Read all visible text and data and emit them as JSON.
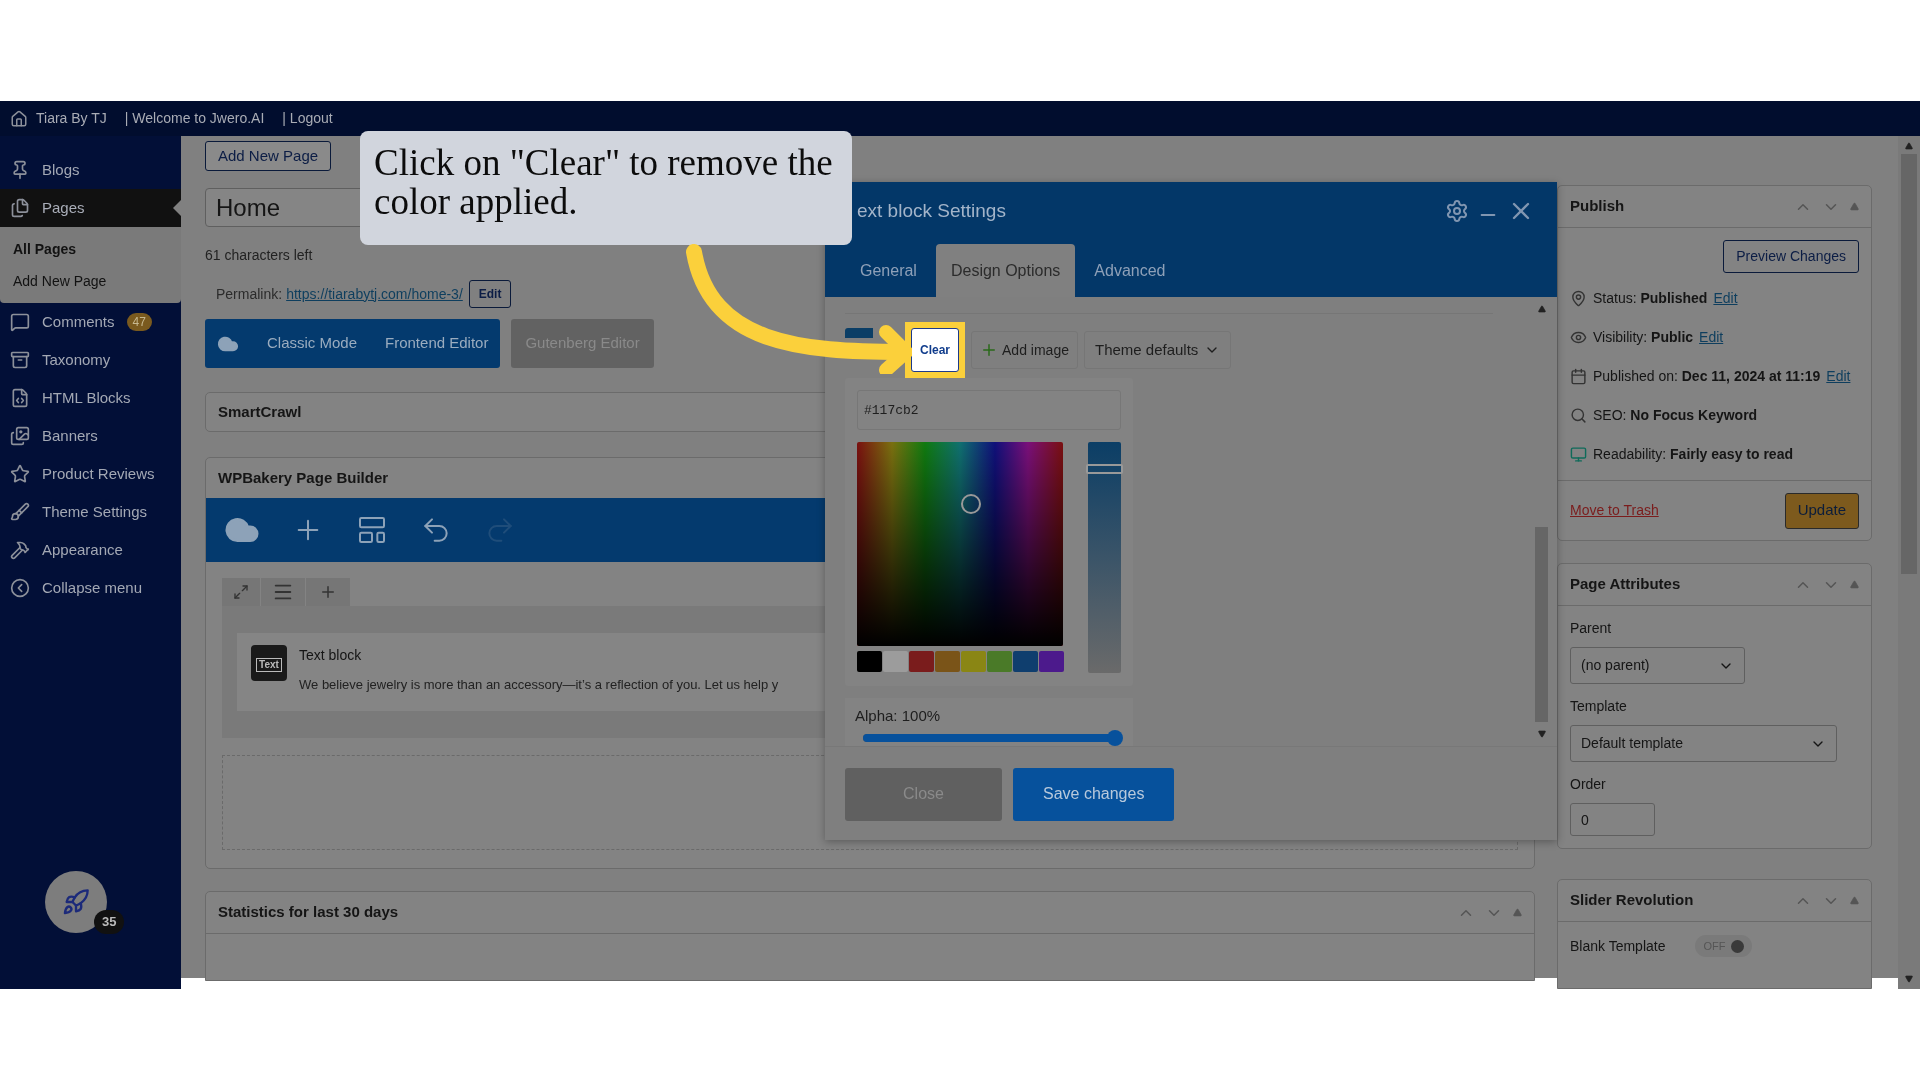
{
  "admin_bar": {
    "site": "Tiara By TJ",
    "links": [
      "| Welcome to Jwero.AI",
      "| Logout"
    ]
  },
  "sidebar": {
    "items": [
      {
        "label": "Blogs",
        "selected": false
      },
      {
        "label": "Pages",
        "selected": true,
        "children": [
          {
            "label": "All Pages",
            "selected": true
          },
          {
            "label": "Add New Page",
            "selected": false
          }
        ]
      },
      {
        "label": "Comments",
        "selected": false,
        "badge": "47"
      },
      {
        "label": "Taxonomy",
        "selected": false
      },
      {
        "label": "HTML Blocks",
        "selected": false
      },
      {
        "label": "Banners",
        "selected": false
      },
      {
        "label": "Product Reviews",
        "selected": false
      },
      {
        "label": "Theme Settings",
        "selected": false
      },
      {
        "label": "Appearance",
        "selected": false
      },
      {
        "label": "Collapse menu",
        "selected": false
      }
    ],
    "floating_badge": "35"
  },
  "editor": {
    "add_new_button": "Add New Page",
    "title_value": "Home",
    "chars_left": "61 characters left",
    "permalink": {
      "label": "Permalink:",
      "url": "https://tiarabytj.com/home-3/",
      "edit": "Edit"
    },
    "modes": [
      {
        "label": "Classic Mode",
        "selected": true
      },
      {
        "label": "Frontend Editor",
        "selected": true
      },
      {
        "label": "Gutenberg Editor",
        "selected": false
      }
    ],
    "smartcrawl_title": "SmartCrawl",
    "builder": {
      "title": "WPBakery Page Builder",
      "element": {
        "icon_text": "Text",
        "title": "Text block",
        "description": "We believe jewelry is more than an accessory—it’s a reflection of you. Let us help y"
      }
    },
    "statistics_title": "Statistics for last 30 days"
  },
  "modal": {
    "title": "ext block Settings",
    "tabs": [
      {
        "label": "General",
        "selected": false
      },
      {
        "label": "Design Options",
        "selected": true
      },
      {
        "label": "Advanced",
        "selected": false
      }
    ],
    "clear_button": "Clear",
    "add_image": "Add image",
    "theme_select": "Theme defaults",
    "picker": {
      "hex": "#117cb2",
      "swatches": [
        {
          "color": "#000000"
        },
        {
          "color": "#9c9c9c"
        },
        {
          "color": "#7a1c1c"
        },
        {
          "color": "#7a5418"
        },
        {
          "color": "#8a8614"
        },
        {
          "color": "#4a7a28"
        },
        {
          "color": "#0f3e6e"
        },
        {
          "color": "#4c1a8c"
        }
      ],
      "shade": {
        "level": 0.9
      },
      "alpha_label": "Alpha: 100%",
      "alpha": {
        "level": 1
      }
    },
    "buttons": [
      {
        "label": "Close",
        "disabled": true
      },
      {
        "label": "Save changes",
        "disabled": false
      }
    ]
  },
  "callout": {
    "text": "Click on \"Clear\" to remove the color applied."
  },
  "publish": {
    "title": "Publish",
    "preview_button": "Preview Changes",
    "rows": [
      {
        "label": "Status:",
        "value": "Published",
        "link": "Edit"
      },
      {
        "label": "Visibility:",
        "value": "Public",
        "link": "Edit"
      },
      {
        "label": "Published on:",
        "value": "Dec 11, 2024 at 11:19",
        "link": "Edit"
      },
      {
        "label": "SEO:",
        "value": "No Focus Keyword"
      },
      {
        "label": "Readability:",
        "value": "Fairly easy to read"
      }
    ],
    "trash_link": "Move to Trash",
    "update_button": "Update"
  },
  "page_attributes": {
    "title": "Page Attributes",
    "parent_label": "Parent",
    "parent_value": "(no parent)",
    "template_label": "Template",
    "template_value": "Default template",
    "order_label": "Order",
    "order_value": "0"
  },
  "slider_revolution": {
    "title": "Slider Revolution",
    "row_label": "Blank Template",
    "toggle": {
      "label": "OFF",
      "on": false
    }
  }
}
